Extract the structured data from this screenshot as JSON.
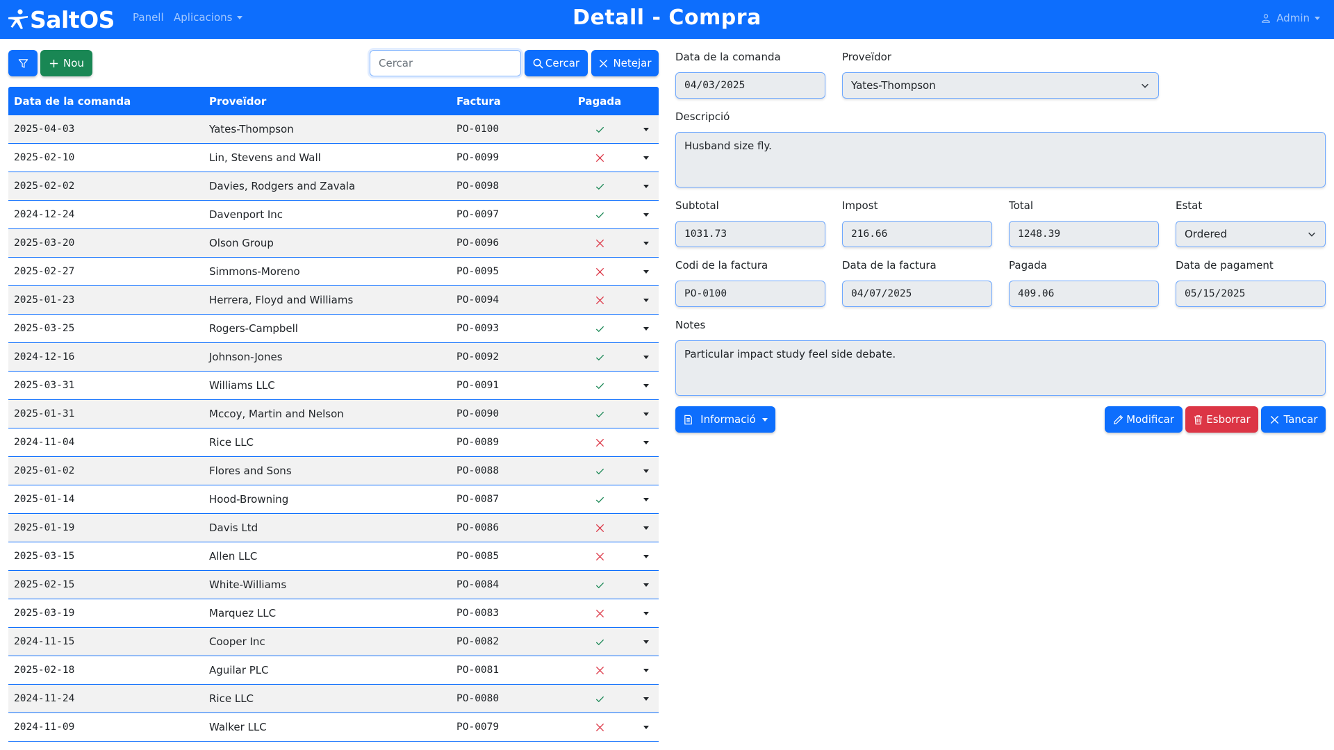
{
  "navbar": {
    "brand": "SaltOS",
    "nav_panell": "Panell",
    "nav_apps": "Aplicacions",
    "title": "Detall - Compra",
    "user": "Admin"
  },
  "toolbar": {
    "new_label": "Nou",
    "search_placeholder": "Cercar",
    "search_label": "Cercar",
    "clear_label": "Netejar"
  },
  "table": {
    "headers": [
      "Data de la comanda",
      "Proveïdor",
      "Factura",
      "Pagada"
    ],
    "rows": [
      {
        "date": "2025-04-03",
        "supplier": "Yates-Thompson",
        "invoice": "PO-0100",
        "paid": true
      },
      {
        "date": "2025-02-10",
        "supplier": "Lin, Stevens and Wall",
        "invoice": "PO-0099",
        "paid": false
      },
      {
        "date": "2025-02-02",
        "supplier": "Davies, Rodgers and Zavala",
        "invoice": "PO-0098",
        "paid": true
      },
      {
        "date": "2024-12-24",
        "supplier": "Davenport Inc",
        "invoice": "PO-0097",
        "paid": true
      },
      {
        "date": "2025-03-20",
        "supplier": "Olson Group",
        "invoice": "PO-0096",
        "paid": false
      },
      {
        "date": "2025-02-27",
        "supplier": "Simmons-Moreno",
        "invoice": "PO-0095",
        "paid": false
      },
      {
        "date": "2025-01-23",
        "supplier": "Herrera, Floyd and Williams",
        "invoice": "PO-0094",
        "paid": false
      },
      {
        "date": "2025-03-25",
        "supplier": "Rogers-Campbell",
        "invoice": "PO-0093",
        "paid": true
      },
      {
        "date": "2024-12-16",
        "supplier": "Johnson-Jones",
        "invoice": "PO-0092",
        "paid": true
      },
      {
        "date": "2025-03-31",
        "supplier": "Williams LLC",
        "invoice": "PO-0091",
        "paid": true
      },
      {
        "date": "2025-01-31",
        "supplier": "Mccoy, Martin and Nelson",
        "invoice": "PO-0090",
        "paid": true
      },
      {
        "date": "2024-11-04",
        "supplier": "Rice LLC",
        "invoice": "PO-0089",
        "paid": false
      },
      {
        "date": "2025-01-02",
        "supplier": "Flores and Sons",
        "invoice": "PO-0088",
        "paid": true
      },
      {
        "date": "2025-01-14",
        "supplier": "Hood-Browning",
        "invoice": "PO-0087",
        "paid": true
      },
      {
        "date": "2025-01-19",
        "supplier": "Davis Ltd",
        "invoice": "PO-0086",
        "paid": false
      },
      {
        "date": "2025-03-15",
        "supplier": "Allen LLC",
        "invoice": "PO-0085",
        "paid": false
      },
      {
        "date": "2025-02-15",
        "supplier": "White-Williams",
        "invoice": "PO-0084",
        "paid": true
      },
      {
        "date": "2025-03-19",
        "supplier": "Marquez LLC",
        "invoice": "PO-0083",
        "paid": false
      },
      {
        "date": "2024-11-15",
        "supplier": "Cooper Inc",
        "invoice": "PO-0082",
        "paid": true
      },
      {
        "date": "2025-02-18",
        "supplier": "Aguilar PLC",
        "invoice": "PO-0081",
        "paid": false
      },
      {
        "date": "2024-11-24",
        "supplier": "Rice LLC",
        "invoice": "PO-0080",
        "paid": true
      },
      {
        "date": "2024-11-09",
        "supplier": "Walker LLC",
        "invoice": "PO-0079",
        "paid": false
      }
    ]
  },
  "form": {
    "order_date_label": "Data de la comanda",
    "order_date": "04/03/2025",
    "supplier_label": "Proveïdor",
    "supplier": "Yates-Thompson",
    "description_label": "Descripció",
    "description": "Husband size fly.",
    "subtotal_label": "Subtotal",
    "subtotal": "1031.73",
    "tax_label": "Impost",
    "tax": "216.66",
    "total_label": "Total",
    "total": "1248.39",
    "status_label": "Estat",
    "status": "Ordered",
    "invoice_code_label": "Codi de la factura",
    "invoice_code": "PO-0100",
    "invoice_date_label": "Data de la factura",
    "invoice_date": "04/07/2025",
    "paid_label": "Pagada",
    "paid": "409.06",
    "payment_date_label": "Data de pagament",
    "payment_date": "05/15/2025",
    "notes_label": "Notes",
    "notes": "Particular impact study feel side debate."
  },
  "actions": {
    "info_label": "Informació",
    "modify_label": "Modificar",
    "delete_label": "Esborrar",
    "close_label": "Tancar"
  },
  "colors": {
    "primary": "#0d6efd",
    "success": "#198754",
    "danger": "#dc3545",
    "check": "#198754",
    "cross": "#dc3545"
  },
  "icons": {
    "filter": "filter-icon",
    "plus": "plus-icon",
    "search": "search-icon",
    "clear": "x-icon",
    "user": "person-icon",
    "document": "document-icon",
    "pencil": "pencil-icon",
    "trash": "trash-icon",
    "close": "x-icon"
  }
}
